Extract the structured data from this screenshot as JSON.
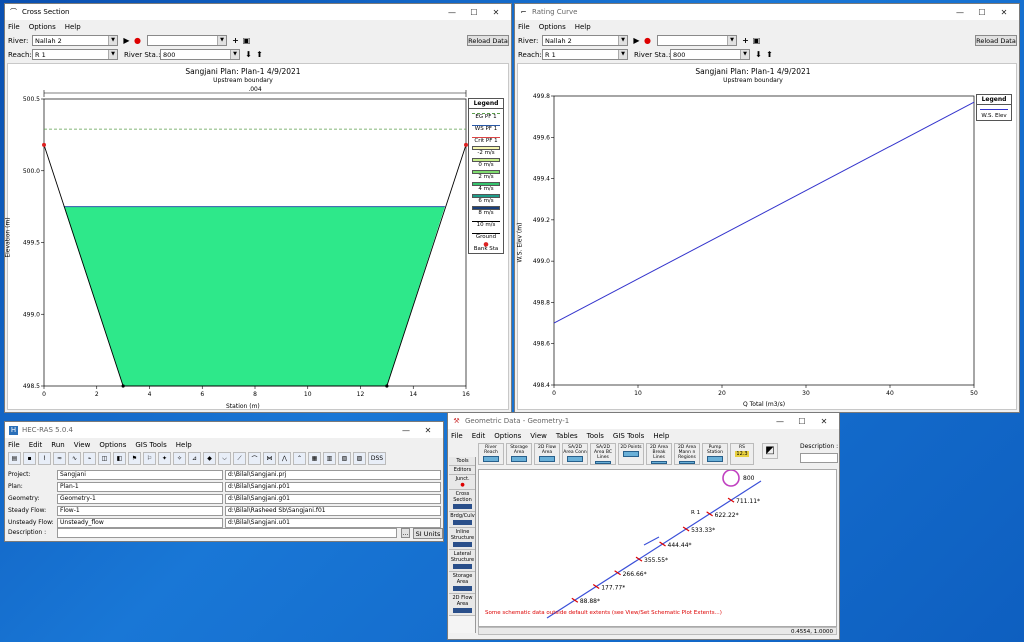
{
  "cross_section": {
    "title": "Cross Section",
    "menu": [
      "File",
      "Options",
      "Help"
    ],
    "river_label": "River:",
    "river_value": "Nallah 2",
    "reach_label": "Reach:",
    "reach_value": "R 1",
    "river_sta_label": "River Sta.:",
    "river_sta_value": "800",
    "reload_label": "Reload Data",
    "plot_title": "Sangjani      Plan: Plan-1      4/9/2021",
    "plot_subtitle": "Upstream boundary",
    "bank_dim_label": ".004",
    "xlabel": "Station (m)",
    "ylabel": "Elevation (m)",
    "xticks": [
      "0",
      "2",
      "4",
      "6",
      "8",
      "10",
      "12",
      "14",
      "16"
    ],
    "yticks": [
      "500.5",
      "500.0",
      "499.5",
      "499.0",
      "498.5"
    ],
    "legend_title": "Legend",
    "legend": [
      {
        "label": "EG PF 1",
        "kind": "dash",
        "color": "#5a9e4a"
      },
      {
        "label": "WS PF 1",
        "kind": "line",
        "color": "#2b5aa8"
      },
      {
        "label": "Crit PF 1",
        "kind": "line",
        "color": "#d44"
      },
      {
        "label": "-2 m/s",
        "kind": "box",
        "color": "#f6f6b0"
      },
      {
        "label": "0 m/s",
        "kind": "box",
        "color": "#c6ef8a"
      },
      {
        "label": "2 m/s",
        "kind": "box",
        "color": "#7fdc6e"
      },
      {
        "label": "4 m/s",
        "kind": "box",
        "color": "#35c46e"
      },
      {
        "label": "6 m/s",
        "kind": "box",
        "color": "#1f9c8a"
      },
      {
        "label": "8 m/s",
        "kind": "box",
        "color": "#1a3f7a"
      },
      {
        "label": "10 m/s",
        "kind": "line",
        "color": "#000"
      },
      {
        "label": "Ground",
        "kind": "line",
        "color": "#000"
      },
      {
        "label": "Bank Sta",
        "kind": "dot",
        "color": "#d22"
      }
    ],
    "fill_color": "#2ee88a"
  },
  "rating_curve": {
    "title": "Rating Curve",
    "menu": [
      "File",
      "Options",
      "Help"
    ],
    "river_label": "River:",
    "river_value": "Nallah 2",
    "reach_label": "Reach:",
    "reach_value": "R 1",
    "river_sta_label": "River Sta.:",
    "river_sta_value": "800",
    "reload_label": "Reload Data",
    "plot_title": "Sangjani      Plan: Plan-1      4/9/2021",
    "plot_subtitle": "Upstream boundary",
    "xlabel": "Q Total  (m3/s)",
    "ylabel": "W.S. Elev  (m)",
    "xticks": [
      "0",
      "10",
      "20",
      "30",
      "40",
      "50"
    ],
    "yticks": [
      "499.8",
      "499.6",
      "499.4",
      "499.2",
      "499.0",
      "498.8",
      "498.6",
      "498.4"
    ],
    "legend_title": "Legend",
    "legend_item": "W.S. Elev",
    "line_color": "#3333cc"
  },
  "hec_ras": {
    "title": "HEC-RAS 5.0.4",
    "menu": [
      "File",
      "Edit",
      "Run",
      "View",
      "Options",
      "GIS Tools",
      "Help"
    ],
    "dss_label": "DSS",
    "fields": [
      {
        "label": "Project:",
        "value": "Sangjani",
        "path": "d:\\Bilal\\Sangjani.prj"
      },
      {
        "label": "Plan:",
        "value": "Plan-1",
        "path": "d:\\Bilal\\Sangjani.p01"
      },
      {
        "label": "Geometry:",
        "value": "Geometry-1",
        "path": "d:\\Bilal\\Sangjani.g01"
      },
      {
        "label": "Steady Flow:",
        "value": "Flow-1",
        "path": "d:\\Bilal\\Rasheed Sb\\Sangjani.f01"
      },
      {
        "label": "Unsteady Flow:",
        "value": "Unsteady_flow",
        "path": "d:\\Bilal\\Sangjani.u01"
      }
    ],
    "description_label": "Description :",
    "si_units": "SI Units"
  },
  "geometric": {
    "title": "Geometric Data - Geometry-1",
    "menu": [
      "File",
      "Edit",
      "Options",
      "View",
      "Tables",
      "Tools",
      "GIS Tools",
      "Help"
    ],
    "tools": [
      {
        "label": "River Reach"
      },
      {
        "label": "Storage Area"
      },
      {
        "label": "2D Flow Area"
      },
      {
        "label": "SA/2D Area Conn"
      },
      {
        "label": "SA/2D Area BC Lines"
      },
      {
        "label": "2D Points"
      },
      {
        "label": "2D Area Break Lines"
      },
      {
        "label": "2D Area Mann n Regions"
      },
      {
        "label": "Pump Station"
      },
      {
        "label": "RS"
      }
    ],
    "rs_value": "12.3",
    "description_label": "Description :",
    "side_tools": [
      "Tools",
      "Editors",
      "Junct.",
      "Cross Section",
      "Brdg/Culv",
      "Inline Structure",
      "Lateral Structure",
      "Storage Area",
      "2D Flow Area"
    ],
    "stations": [
      "711.11*",
      "622.22*",
      "533.33*",
      "444.44*",
      "355.55*",
      "266.66*",
      "177.77*",
      "88.88*"
    ],
    "reach_label": "R 1",
    "top_station": "800",
    "warning": "Some schematic data outside default extents (see View/Set Schematic Plot Extents...)",
    "coords": "0.4554, 1.0000"
  }
}
